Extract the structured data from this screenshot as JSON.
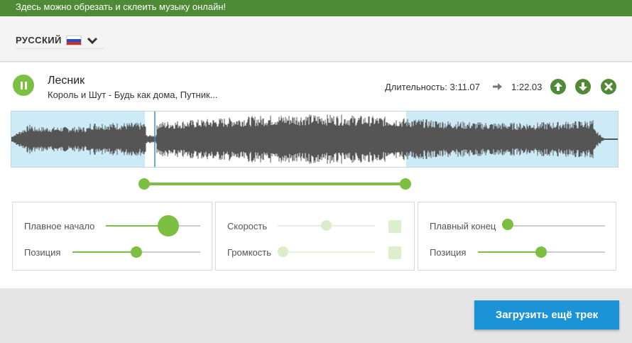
{
  "banner": {
    "text": "Здесь можно обрезать и склеить музыку онлайн!"
  },
  "language": {
    "label": "РУССКИЙ",
    "flag_icon": "russia-flag-icon",
    "dropdown_icon": "chevron-down-icon"
  },
  "track": {
    "title": "Лесник",
    "artist": "Король и Шут - Будь как дома, Путник...",
    "duration_label": "Длительность: 3:11.07",
    "selection_duration": "1:22.03",
    "state": "playing",
    "selection_start_fraction": 0.219,
    "selection_end_fraction": 0.649
  },
  "actions": {
    "move_up_icon": "arrow-up-icon",
    "move_down_icon": "arrow-down-icon",
    "remove_icon": "close-icon"
  },
  "controls": {
    "fade_in": {
      "label": "Плавное начало",
      "value": 0.66
    },
    "position_left": {
      "label": "Позиция",
      "value": 0.5
    },
    "speed": {
      "label": "Скорость",
      "value": 0.5,
      "enabled": false
    },
    "volume": {
      "label": "Громкость",
      "value": 0.0,
      "enabled": false
    },
    "fade_out": {
      "label": "Плавный конец",
      "value": 0.0
    },
    "position_right": {
      "label": "Позиция",
      "value": 0.5
    }
  },
  "upload_button": {
    "label": "Загрузить ещё трек"
  },
  "colors": {
    "green": "#7bc043",
    "dark_green": "#4f8a36",
    "blue": "#1b93d6",
    "selection_blue": "#cdeaf7",
    "waveform": "#555555"
  }
}
